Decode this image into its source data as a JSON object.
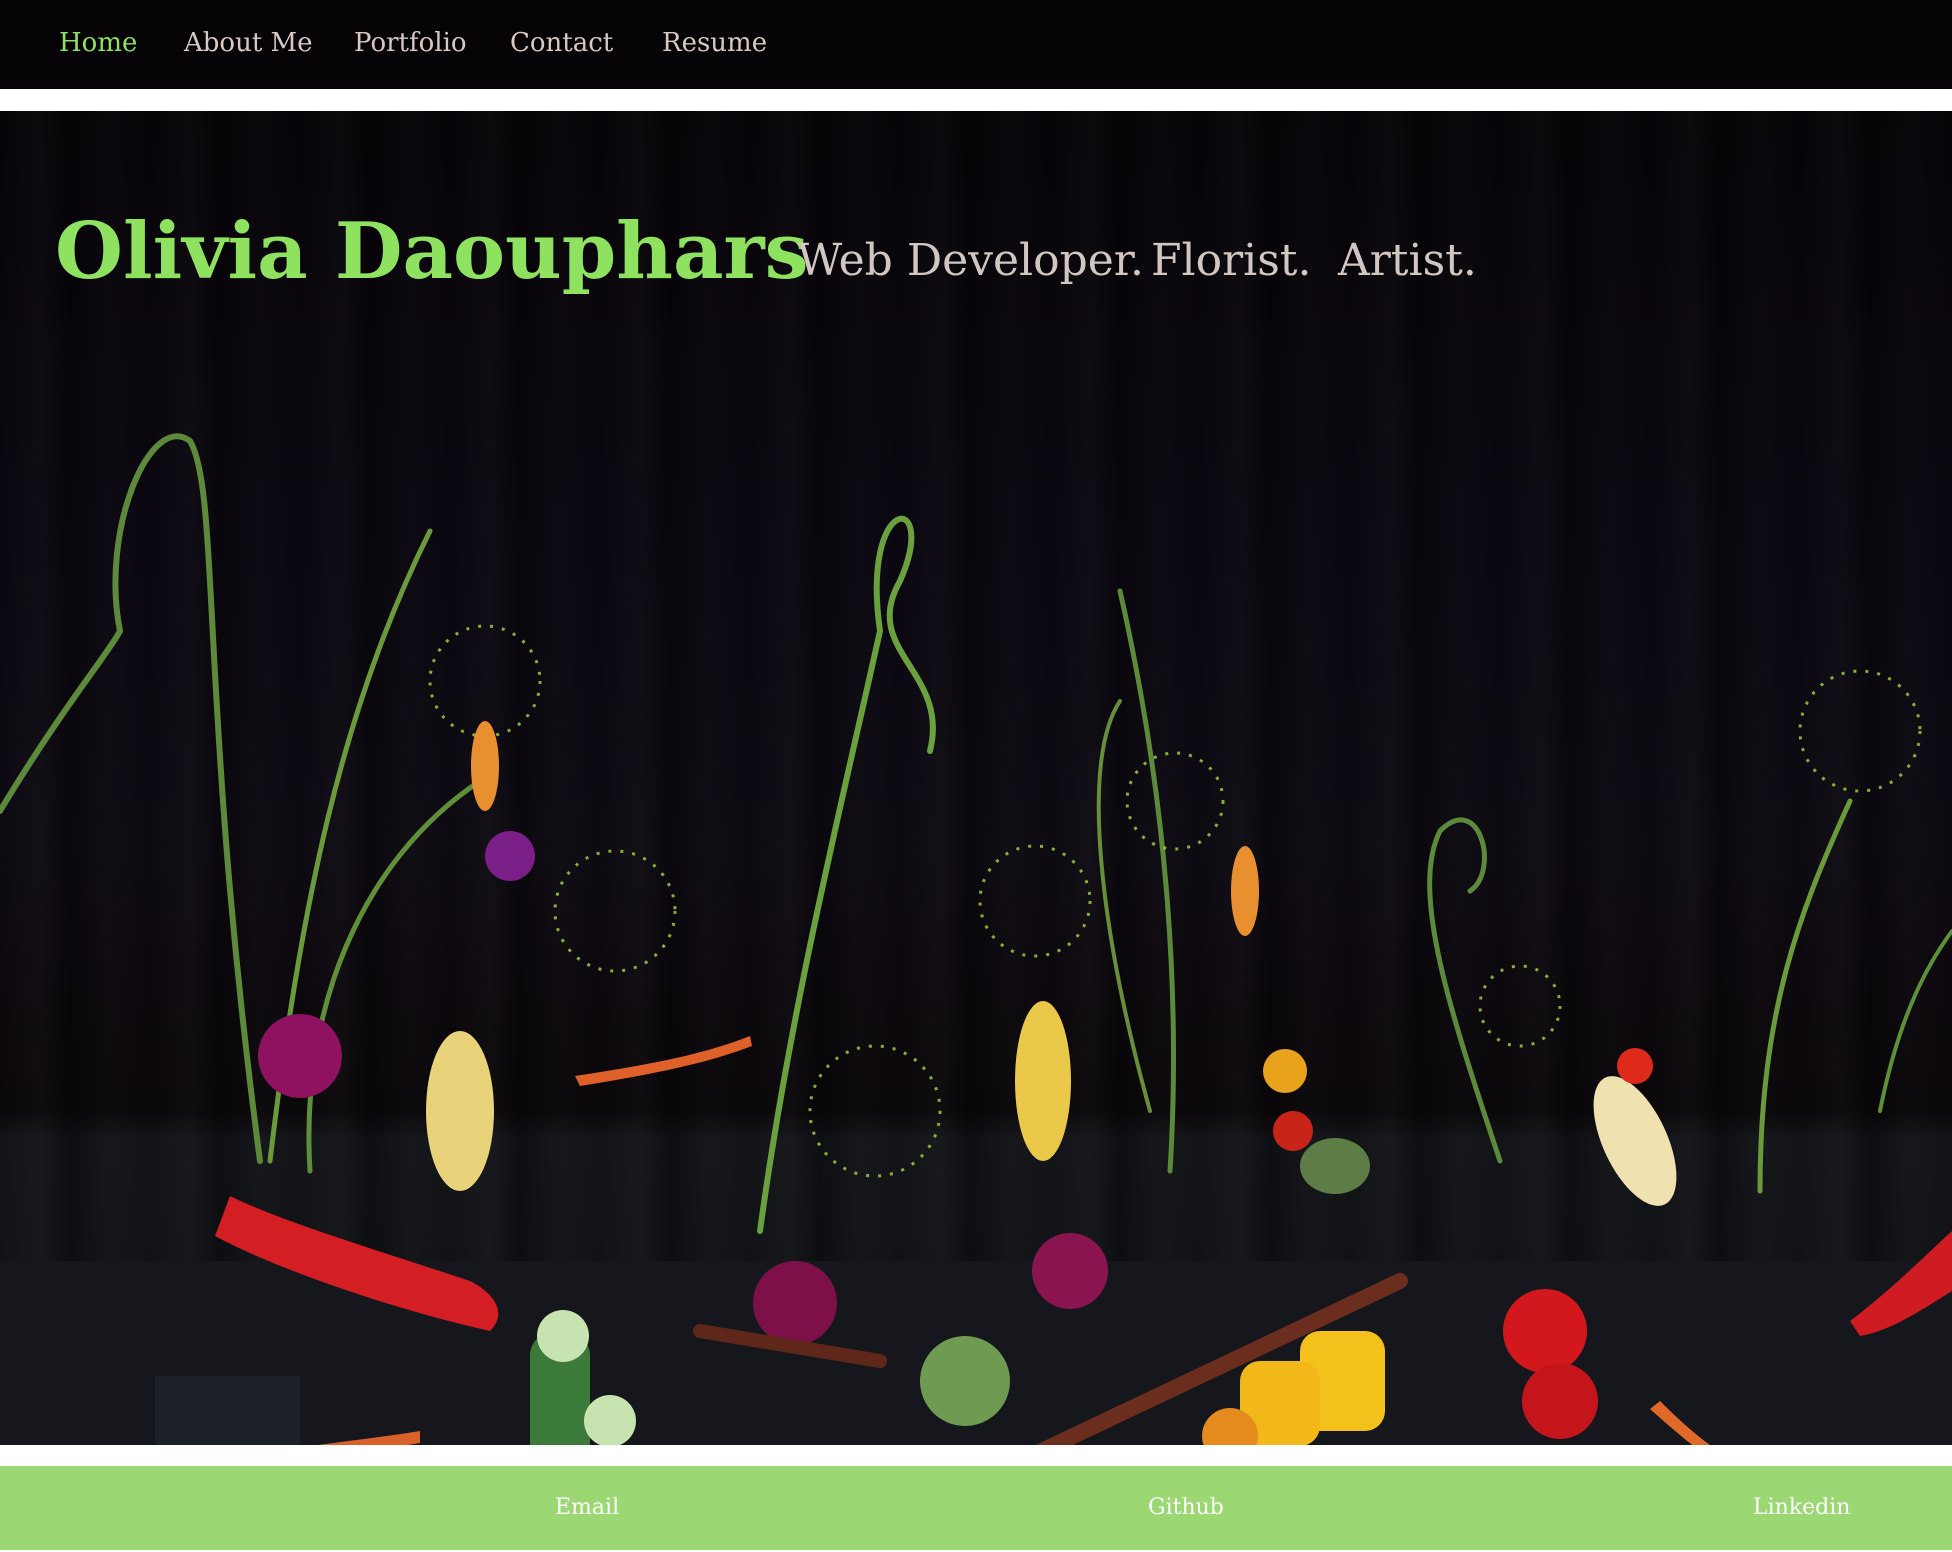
{
  "nav": {
    "items": [
      {
        "label": "Home",
        "active": true
      },
      {
        "label": "About Me"
      },
      {
        "label": "Portfolio"
      },
      {
        "label": "Contact"
      },
      {
        "label": "Resume"
      }
    ]
  },
  "hero": {
    "name": "Olivia Daouphars",
    "taglines": [
      "Web Developer.",
      "Florist.",
      "Artist."
    ],
    "image_description_icon": "vegetable-flower-arrangement-image"
  },
  "footer": {
    "links": [
      "Email",
      "Github",
      "Linkedin"
    ]
  },
  "colors": {
    "accent": "#8fe160",
    "nav_bg": "#050305",
    "nav_text": "#d8c8c4",
    "footer_bg": "#9bd873",
    "footer_text": "#ffffff"
  }
}
